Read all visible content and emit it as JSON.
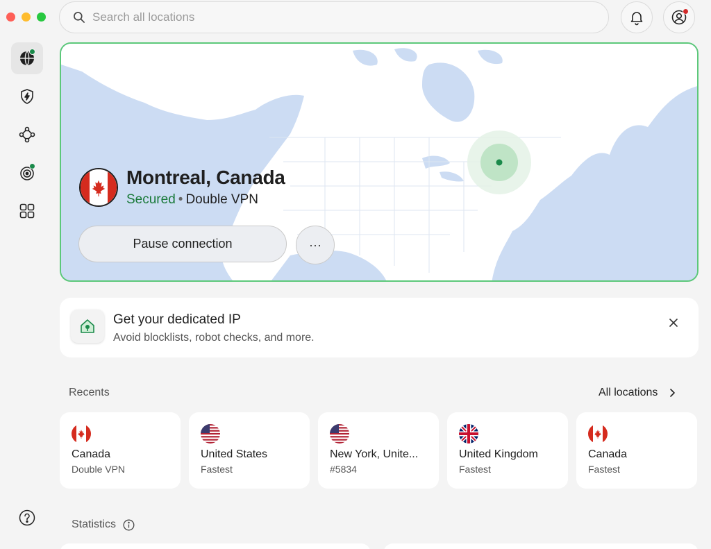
{
  "search": {
    "placeholder": "Search all locations"
  },
  "sidebar": {
    "items": [
      {
        "icon": "globe-icon",
        "active": true,
        "dot": true
      },
      {
        "icon": "shield-bolt-icon",
        "active": false,
        "dot": false
      },
      {
        "icon": "mesh-network-icon",
        "active": false,
        "dot": false
      },
      {
        "icon": "radar-target-icon",
        "active": false,
        "dot": true
      },
      {
        "icon": "grid-apps-icon",
        "active": false,
        "dot": false
      }
    ],
    "help_icon": "help-icon"
  },
  "connection": {
    "location": "Montreal, Canada",
    "status": "Secured",
    "separator": "•",
    "mode": "Double VPN",
    "pause_label": "Pause connection",
    "more_label": "···"
  },
  "promo": {
    "title": "Get your dedicated IP",
    "subtitle": "Avoid blocklists, robot checks, and more."
  },
  "recents": {
    "label": "Recents",
    "all_label": "All locations",
    "items": [
      {
        "flag": "ca",
        "name": "Canada",
        "sub": "Double VPN"
      },
      {
        "flag": "us",
        "name": "United States",
        "sub": "Fastest"
      },
      {
        "flag": "us",
        "name": "New York, Unite...",
        "sub": "#5834"
      },
      {
        "flag": "gb",
        "name": "United Kingdom",
        "sub": "Fastest"
      },
      {
        "flag": "ca",
        "name": "Canada",
        "sub": "Fastest"
      }
    ]
  },
  "statistics": {
    "label": "Statistics"
  },
  "colors": {
    "accent_green": "#1a7a3a",
    "map_border": "#5cc87a",
    "map_water": "#ccdcf3",
    "notification_dot": "#d22b2b"
  }
}
